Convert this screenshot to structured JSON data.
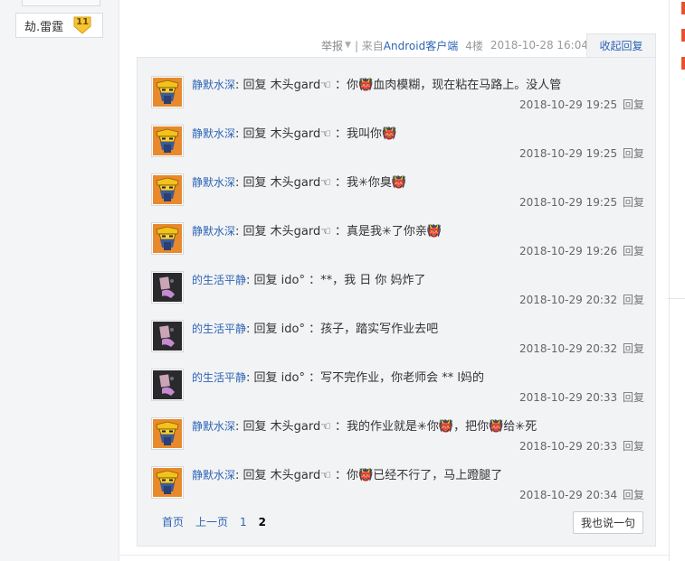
{
  "profile": {
    "username": "劫.雷霆",
    "level": "11"
  },
  "post_meta": {
    "report_label": "举报",
    "separator": "| 来自",
    "source_link": "Android客户端",
    "floor": "4楼",
    "time": "2018-10-28 16:04",
    "collapse_label": "收起回复"
  },
  "replies": [
    {
      "user": "静默水深",
      "text": ": 回复 木头gard☜ ：你👹血肉模糊，现在粘在马路上。没人管",
      "time": "2018-10-29 19:25",
      "reply_label": "回复",
      "avatar": "mask"
    },
    {
      "user": "静默水深",
      "text": ": 回复 木头gard☜ ：我叫你👹",
      "time": "2018-10-29 19:25",
      "reply_label": "回复",
      "avatar": "mask"
    },
    {
      "user": "静默水深",
      "text": ": 回复 木头gard☜ ：我✳你臭👹",
      "time": "2018-10-29 19:25",
      "reply_label": "回复",
      "avatar": "mask"
    },
    {
      "user": "静默水深",
      "text": ": 回复 木头gard☜ ：真是我✳了你亲👹",
      "time": "2018-10-29 19:26",
      "reply_label": "回复",
      "avatar": "mask"
    },
    {
      "user": "的生活平静",
      "text": ": 回复 ido° ：**，我 日 你 妈炸了",
      "time": "2018-10-29 20:32",
      "reply_label": "回复",
      "avatar": "dark"
    },
    {
      "user": "的生活平静",
      "text": ": 回复 ido° ：孩子，踏实写作业去吧",
      "time": "2018-10-29 20:32",
      "reply_label": "回复",
      "avatar": "dark"
    },
    {
      "user": "的生活平静",
      "text": ": 回复 ido° ：写不完作业，你老师会 ** l妈的",
      "time": "2018-10-29 20:33",
      "reply_label": "回复",
      "avatar": "dark"
    },
    {
      "user": "静默水深",
      "text": ": 回复 木头gard☜ ：我的作业就是✳你👹，把你👹给✳死",
      "time": "2018-10-29 20:33",
      "reply_label": "回复",
      "avatar": "mask"
    },
    {
      "user": "静默水深",
      "text": ": 回复 木头gard☜ ：你👹已经不行了，马上蹬腿了",
      "time": "2018-10-29 20:34",
      "reply_label": "回复",
      "avatar": "mask"
    }
  ],
  "pager": {
    "first": "首页",
    "prev": "上一页",
    "page1": "1",
    "page2": "2"
  },
  "say_button": "我也说一句",
  "colors": {
    "link": "#2d64b3",
    "reply_bg": "#f2f3f5",
    "accent": "#e5532e"
  }
}
